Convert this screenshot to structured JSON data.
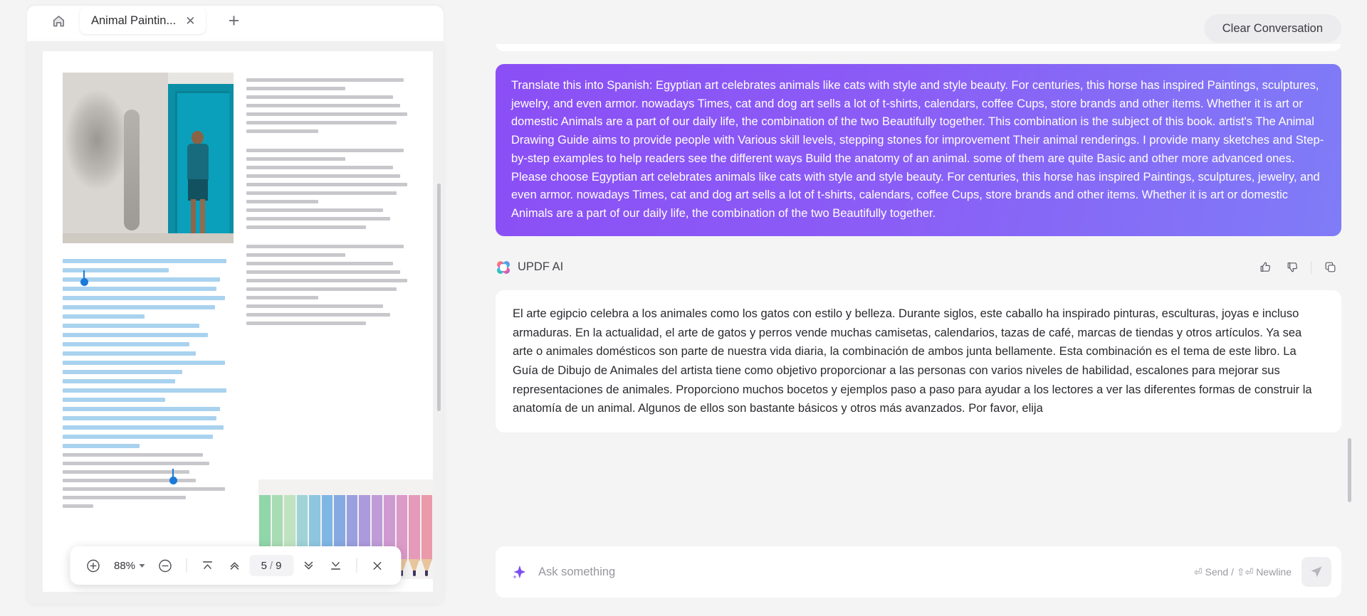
{
  "window": {
    "home_icon": "home-icon",
    "new_tab_icon": "plus-icon",
    "tabs": [
      {
        "title": "Animal Paintin...",
        "close_icon": "close-icon"
      }
    ]
  },
  "pdf": {
    "toolbar": {
      "zoom_in_icon": "plus-circle-icon",
      "zoom_level": "88%",
      "zoom_dropdown_icon": "chevron-down-icon",
      "zoom_out_icon": "minus-circle-icon",
      "first_page_icon": "first-page-icon",
      "prev_page_icon": "chevron-up-icon",
      "current_page": "5",
      "page_separator": "/",
      "total_pages": "9",
      "next_page_icon": "chevron-down-icon",
      "last_page_icon": "last-page-icon",
      "close_icon": "close-icon"
    },
    "page_content": {
      "image_caption": "elephant-drawing-and-person-in-teal-doorway",
      "pencils_caption": "colored-pencils-photo",
      "paragraphs": [
        "Egyptian art celebrates animals like cats with style and style beauty. For centuries, this horse has inspired",
        "Paintings, sculptures, jewelry, and even armor. nowadays",
        "Times, cat and dog art sells a lot of t-shirts, calendars, coffee",
        "Cups, store brands and other items. Whether it is art or domestic",
        "Animals are a part of our daily life, the combination of the two",
        "Beautifully together.",
        "This combination is the subject of this book. artist's",
        "The Animal Drawing Guide aims to provide people with",
        "Various skill levels, stepping stones for improvement",
        "Their animal renderings. I provide many sketches and",
        "Step-by-step examples to help readers see the different ways",
        "Build the anatomy of an animal. some of them are quite",
        "Basic and other more advanced ones. Please choose"
      ]
    }
  },
  "chat": {
    "clear_button": "Clear Conversation",
    "user_message": "Translate this into Spanish: Egyptian art celebrates animals like cats with style and style beauty. For centuries, this horse has inspired Paintings, sculptures, jewelry, and even armor. nowadays Times, cat and dog art sells a lot of t-shirts, calendars, coffee Cups, store brands and other items. Whether it is art or domestic Animals are a part of our daily life, the combination of the two Beautifully together. This combination is the subject of this book. artist's The Animal Drawing Guide aims to provide people with Various skill levels, stepping stones for improvement Their animal renderings. I provide many sketches and Step-by-step examples to help readers see the different ways Build the anatomy of an animal. some of them are quite Basic and other more advanced ones. Please choose Egyptian art celebrates animals like cats with style and style beauty. For centuries, this horse has inspired Paintings, sculptures, jewelry, and even armor. nowadays Times, cat and dog art sells a lot of t-shirts, calendars, coffee Cups, store brands and other items. Whether it is art or domestic Animals are a part of our daily life, the combination of the two Beautifully together.",
    "assistant_name": "UPDF AI",
    "assistant_logo_icon": "updf-ai-clover-icon",
    "thumbs_up_icon": "thumbs-up-icon",
    "thumbs_down_icon": "thumbs-down-icon",
    "copy_icon": "copy-icon",
    "assistant_message": "El arte egipcio celebra a los animales como los gatos con estilo y belleza. Durante siglos, este caballo ha inspirado pinturas, esculturas, joyas e incluso armaduras. En la actualidad, el arte de gatos y perros vende muchas camisetas, calendarios, tazas de café, marcas de tiendas y otros artículos. Ya sea arte o animales domésticos son parte de nuestra vida diaria, la combinación de ambos junta bellamente. Esta combinación es el tema de este libro. La Guía de Dibujo de Animales del artista tiene como objetivo proporcionar a las personas con varios niveles de habilidad, escalones para mejorar sus representaciones de animales. Proporciono muchos bocetos y ejemplos paso a paso para ayudar a los lectores a ver las diferentes formas de construir la anatomía de un animal. Algunos de ellos son bastante básicos y otros más avanzados. Por favor, elija"
  },
  "composer": {
    "sparkle_icon": "sparkle-icon",
    "placeholder": "Ask something",
    "value": "",
    "hint": "⏎ Send / ⇧⏎ Newline",
    "send_icon": "send-icon"
  },
  "colors": {
    "user_bubble": "#8b5cf6",
    "accent_blue": "#1a7ad9",
    "page_bg": "#f4f4f5",
    "card_bg": "#ffffff"
  }
}
